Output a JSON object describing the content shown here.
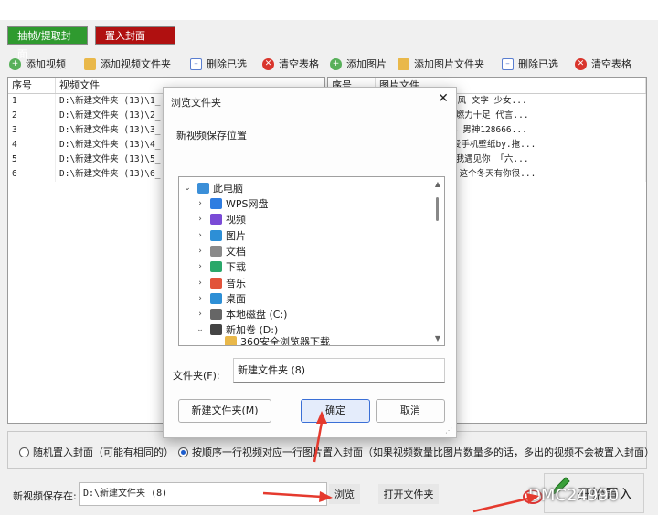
{
  "tabs": {
    "extract": "抽帧/提取封面",
    "insert": "置入封面"
  },
  "toolbar_left": {
    "add_video": "添加视频",
    "add_video_folder": "添加视频文件夹",
    "delete_selected": "删除已选",
    "clear_table": "清空表格"
  },
  "toolbar_right": {
    "add_image": "添加图片",
    "add_image_folder": "添加图片文件夹",
    "delete_selected": "删除已选",
    "clear_table": "清空表格"
  },
  "video_table": {
    "headers": {
      "no": "序号",
      "file": "视频文件"
    },
    "rows": [
      {
        "no": "1",
        "file": "D:\\新建文件夹 (13)\\1_"
      },
      {
        "no": "2",
        "file": "D:\\新建文件夹 (13)\\2_"
      },
      {
        "no": "3",
        "file": "D:\\新建文件夹 (13)\\3_"
      },
      {
        "no": "4",
        "file": "D:\\新建文件夹 (13)\\4_"
      },
      {
        "no": "5",
        "file": "D:\\新建文件夹 (13)\\5_"
      },
      {
        "no": "6",
        "file": "D:\\新建文件夹 (13)\\6_"
      }
    ]
  },
  "image_table": {
    "headers": {
      "no": "序号",
      "file": "图片文件"
    },
    "rows": [
      {
        "file": "3)\\动画 可爱 韩国风 文字 少女..."
      },
      {
        "file": "3)\\陈伟霆运动大片燃力十足 代言..."
      },
      {
        "file": "3)\\壁纸  明星 摄影 男神128666..."
      },
      {
        "file": "3)\\exolay卡通可爱手机壁纸by.拖..."
      },
      {
        "file": "3)\\【】承蒙时光让我遇见你 「六..."
      },
      {
        "file": "3)\\[分享]180115 这个冬天有你很..."
      }
    ]
  },
  "dialog": {
    "title": "浏览文件夹",
    "hint": "新视频保存位置",
    "tree": {
      "root": "此电脑",
      "items": [
        "WPS网盘",
        "视频",
        "图片",
        "文档",
        "下载",
        "音乐",
        "桌面",
        "本地磁盘 (C:)",
        "新加卷 (D:)"
      ],
      "partial": "360安全浏览器下载"
    },
    "folder_label": "文件夹(F):",
    "folder_value": "新建文件夹 (8)",
    "new_folder": "新建文件夹(M)",
    "ok": "确定",
    "cancel": "取消"
  },
  "options": {
    "random": "随机置入封面（可能有相同的）",
    "sequential": "按顺序一行视频对应一行图片置入封面（如果视频数量比图片数量多的话，多出的视频不会被置入封面）"
  },
  "save": {
    "label": "新视频保存在:",
    "path": "D:\\新建文件夹 (8)",
    "browse": "浏览",
    "open_folder": "打开文件夹"
  },
  "start": "开始置入",
  "watermark": "DMC24990",
  "colors": {
    "extract_tab": "#2f9a2f",
    "insert_tab": "#b01010",
    "arrow": "#e53a2e"
  }
}
